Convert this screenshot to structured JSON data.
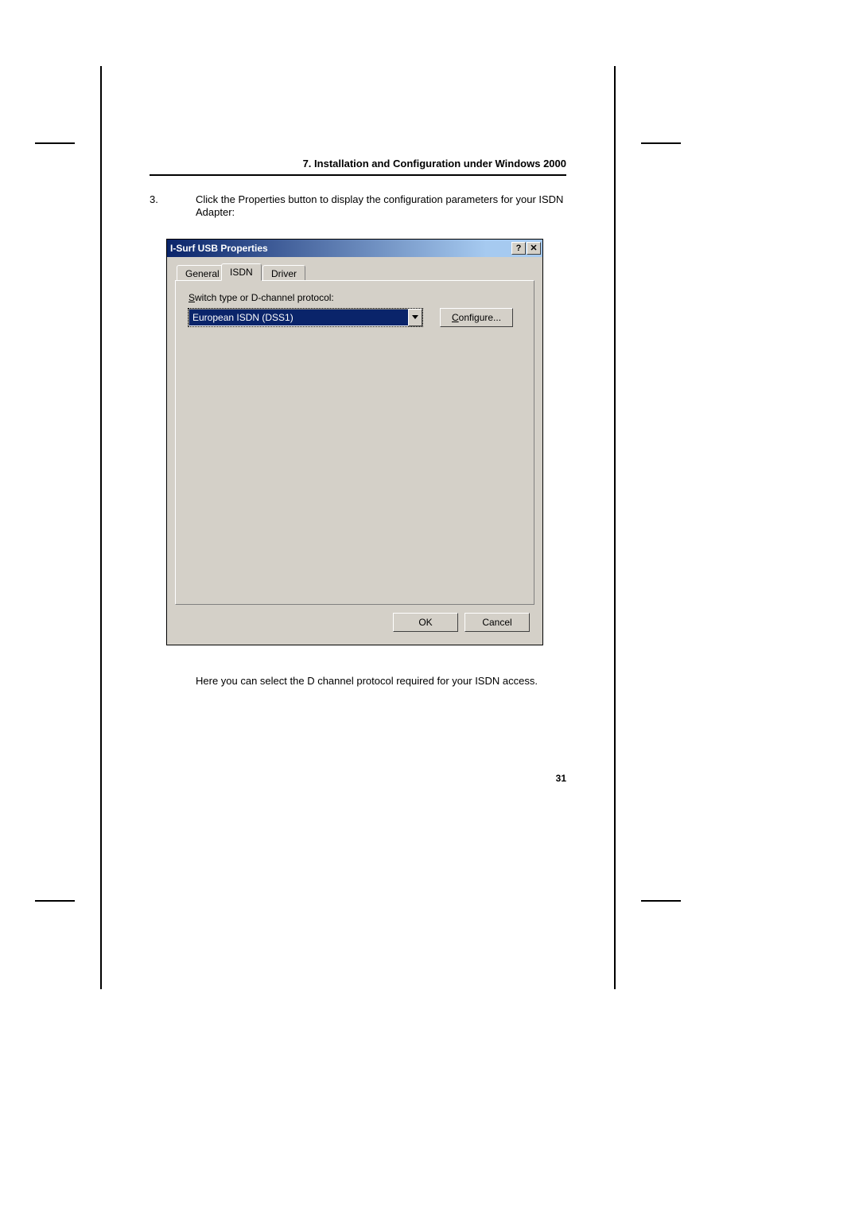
{
  "header": "7. Installation and Configuration under Windows 2000",
  "step": {
    "number": "3.",
    "text": "Click the Properties button to display the configuration parameters for your ISDN Adapter:"
  },
  "dialog": {
    "title": "I-Surf USB Properties",
    "help_icon": "?",
    "close_icon": "✕",
    "tabs": [
      "General",
      "ISDN",
      "Driver"
    ],
    "active_tab_index": 1,
    "switch_label_prefix": "S",
    "switch_label_rest": "witch type or D-channel protocol:",
    "combo_value": "European ISDN (DSS1)",
    "configure_prefix": "C",
    "configure_rest": "onfigure...",
    "ok_label": "OK",
    "cancel_label": "Cancel"
  },
  "caption": "Here you can select the D channel protocol required for your ISDN access.",
  "page_number": "31"
}
